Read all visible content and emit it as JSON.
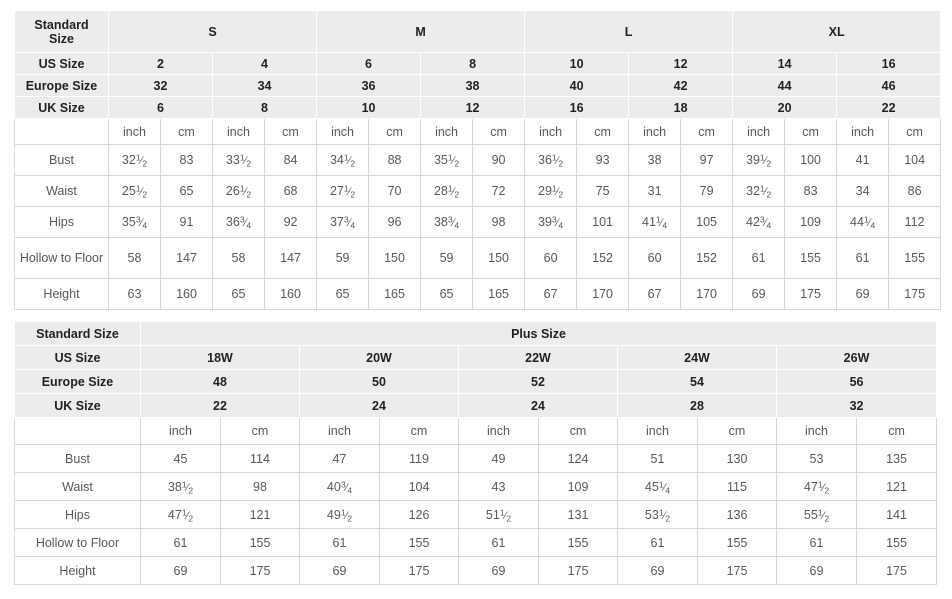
{
  "standard_table": {
    "name": "standard-size-chart",
    "corner_label": "Standard Size",
    "size_groups": [
      {
        "label": "S",
        "span": 2
      },
      {
        "label": "M",
        "span": 2
      },
      {
        "label": "L",
        "span": 2
      },
      {
        "label": "XL",
        "span": 2
      }
    ],
    "rows_header": [
      {
        "label": "US Size",
        "values": [
          "2",
          "4",
          "6",
          "8",
          "10",
          "12",
          "14",
          "16"
        ]
      },
      {
        "label": "Europe Size",
        "values": [
          "32",
          "34",
          "36",
          "38",
          "40",
          "42",
          "44",
          "46"
        ]
      },
      {
        "label": "UK Size",
        "values": [
          "6",
          "8",
          "10",
          "12",
          "16",
          "18",
          "20",
          "22"
        ]
      }
    ],
    "unit_row": {
      "label": "",
      "units": [
        "inch",
        "cm",
        "inch",
        "cm",
        "inch",
        "cm",
        "inch",
        "cm",
        "inch",
        "cm",
        "inch",
        "cm",
        "inch",
        "cm",
        "inch",
        "cm"
      ]
    },
    "measurements": [
      {
        "label": "Bust",
        "values": [
          {
            "whole": "32",
            "num": "1",
            "den": "2"
          },
          {
            "whole": "83"
          },
          {
            "whole": "33",
            "num": "1",
            "den": "2"
          },
          {
            "whole": "84"
          },
          {
            "whole": "34",
            "num": "1",
            "den": "2"
          },
          {
            "whole": "88"
          },
          {
            "whole": "35",
            "num": "1",
            "den": "2"
          },
          {
            "whole": "90"
          },
          {
            "whole": "36",
            "num": "1",
            "den": "2"
          },
          {
            "whole": "93"
          },
          {
            "whole": "38"
          },
          {
            "whole": "97"
          },
          {
            "whole": "39",
            "num": "1",
            "den": "2"
          },
          {
            "whole": "100"
          },
          {
            "whole": "41"
          },
          {
            "whole": "104"
          }
        ]
      },
      {
        "label": "Waist",
        "values": [
          {
            "whole": "25",
            "num": "1",
            "den": "2"
          },
          {
            "whole": "65"
          },
          {
            "whole": "26",
            "num": "1",
            "den": "2"
          },
          {
            "whole": "68"
          },
          {
            "whole": "27",
            "num": "1",
            "den": "2"
          },
          {
            "whole": "70"
          },
          {
            "whole": "28",
            "num": "1",
            "den": "2"
          },
          {
            "whole": "72"
          },
          {
            "whole": "29",
            "num": "1",
            "den": "2"
          },
          {
            "whole": "75"
          },
          {
            "whole": "31"
          },
          {
            "whole": "79"
          },
          {
            "whole": "32",
            "num": "1",
            "den": "2"
          },
          {
            "whole": "83"
          },
          {
            "whole": "34"
          },
          {
            "whole": "86"
          }
        ]
      },
      {
        "label": "Hips",
        "values": [
          {
            "whole": "35",
            "num": "3",
            "den": "4"
          },
          {
            "whole": "91"
          },
          {
            "whole": "36",
            "num": "3",
            "den": "4"
          },
          {
            "whole": "92"
          },
          {
            "whole": "37",
            "num": "3",
            "den": "4"
          },
          {
            "whole": "96"
          },
          {
            "whole": "38",
            "num": "3",
            "den": "4"
          },
          {
            "whole": "98"
          },
          {
            "whole": "39",
            "num": "3",
            "den": "4"
          },
          {
            "whole": "101"
          },
          {
            "whole": "41",
            "num": "1",
            "den": "4"
          },
          {
            "whole": "105"
          },
          {
            "whole": "42",
            "num": "3",
            "den": "4"
          },
          {
            "whole": "109"
          },
          {
            "whole": "44",
            "num": "1",
            "den": "4"
          },
          {
            "whole": "112"
          }
        ]
      },
      {
        "label": "Hollow to Floor",
        "values": [
          {
            "whole": "58"
          },
          {
            "whole": "147"
          },
          {
            "whole": "58"
          },
          {
            "whole": "147"
          },
          {
            "whole": "59"
          },
          {
            "whole": "150"
          },
          {
            "whole": "59"
          },
          {
            "whole": "150"
          },
          {
            "whole": "60"
          },
          {
            "whole": "152"
          },
          {
            "whole": "60"
          },
          {
            "whole": "152"
          },
          {
            "whole": "61"
          },
          {
            "whole": "155"
          },
          {
            "whole": "61"
          },
          {
            "whole": "155"
          }
        ]
      },
      {
        "label": "Height",
        "values": [
          {
            "whole": "63"
          },
          {
            "whole": "160"
          },
          {
            "whole": "65"
          },
          {
            "whole": "160"
          },
          {
            "whole": "65"
          },
          {
            "whole": "165"
          },
          {
            "whole": "65"
          },
          {
            "whole": "165"
          },
          {
            "whole": "67"
          },
          {
            "whole": "170"
          },
          {
            "whole": "67"
          },
          {
            "whole": "170"
          },
          {
            "whole": "69"
          },
          {
            "whole": "175"
          },
          {
            "whole": "69"
          },
          {
            "whole": "175"
          }
        ]
      }
    ]
  },
  "plus_table": {
    "name": "plus-size-chart",
    "corner_label": "Standard Size",
    "title": "Plus Size",
    "rows_header": [
      {
        "label": "US Size",
        "values": [
          "18W",
          "20W",
          "22W",
          "24W",
          "26W"
        ]
      },
      {
        "label": "Europe Size",
        "values": [
          "48",
          "50",
          "52",
          "54",
          "56"
        ]
      },
      {
        "label": "UK Size",
        "values": [
          "22",
          "24",
          "24",
          "28",
          "32"
        ]
      }
    ],
    "unit_row": {
      "label": "",
      "units": [
        "inch",
        "cm",
        "inch",
        "cm",
        "inch",
        "cm",
        "inch",
        "cm",
        "inch",
        "cm"
      ]
    },
    "measurements": [
      {
        "label": "Bust",
        "values": [
          {
            "whole": "45"
          },
          {
            "whole": "114"
          },
          {
            "whole": "47"
          },
          {
            "whole": "119"
          },
          {
            "whole": "49"
          },
          {
            "whole": "124"
          },
          {
            "whole": "51"
          },
          {
            "whole": "130"
          },
          {
            "whole": "53"
          },
          {
            "whole": "135"
          }
        ]
      },
      {
        "label": "Waist",
        "values": [
          {
            "whole": "38",
            "num": "1",
            "den": "2"
          },
          {
            "whole": "98"
          },
          {
            "whole": "40",
            "num": "3",
            "den": "4"
          },
          {
            "whole": "104"
          },
          {
            "whole": "43"
          },
          {
            "whole": "109"
          },
          {
            "whole": "45",
            "num": "1",
            "den": "4"
          },
          {
            "whole": "115"
          },
          {
            "whole": "47",
            "num": "1",
            "den": "2"
          },
          {
            "whole": "121"
          }
        ]
      },
      {
        "label": "Hips",
        "values": [
          {
            "whole": "47",
            "num": "1",
            "den": "2"
          },
          {
            "whole": "121"
          },
          {
            "whole": "49",
            "num": "1",
            "den": "2"
          },
          {
            "whole": "126"
          },
          {
            "whole": "51",
            "num": "1",
            "den": "2"
          },
          {
            "whole": "131"
          },
          {
            "whole": "53",
            "num": "1",
            "den": "2"
          },
          {
            "whole": "136"
          },
          {
            "whole": "55",
            "num": "1",
            "den": "2"
          },
          {
            "whole": "141"
          }
        ]
      },
      {
        "label": "Hollow to Floor",
        "values": [
          {
            "whole": "61"
          },
          {
            "whole": "155"
          },
          {
            "whole": "61"
          },
          {
            "whole": "155"
          },
          {
            "whole": "61"
          },
          {
            "whole": "155"
          },
          {
            "whole": "61"
          },
          {
            "whole": "155"
          },
          {
            "whole": "61"
          },
          {
            "whole": "155"
          }
        ]
      },
      {
        "label": "Height",
        "values": [
          {
            "whole": "69"
          },
          {
            "whole": "175"
          },
          {
            "whole": "69"
          },
          {
            "whole": "175"
          },
          {
            "whole": "69"
          },
          {
            "whole": "175"
          },
          {
            "whole": "69"
          },
          {
            "whole": "175"
          },
          {
            "whole": "69"
          },
          {
            "whole": "175"
          }
        ]
      }
    ]
  },
  "colors": {
    "header_bg": "#ececec",
    "cell_border": "#d8d8d8",
    "header_text": "#222222",
    "body_text": "#58595b",
    "unit_text": "#7b7b7b"
  }
}
